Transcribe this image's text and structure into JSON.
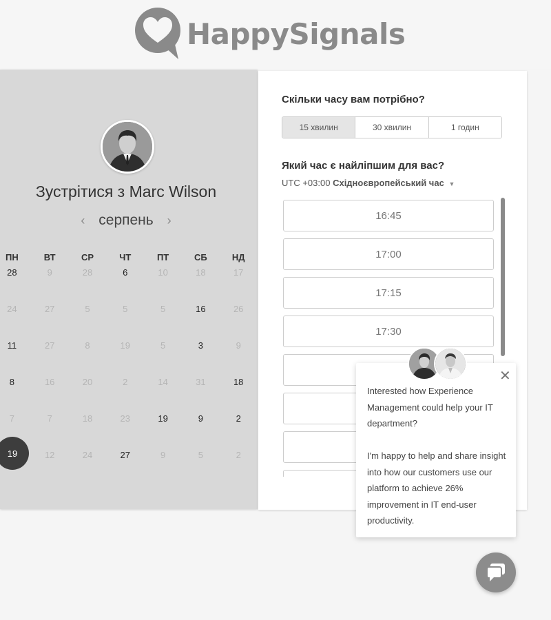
{
  "brand": {
    "name": "HappySignals",
    "logo_icon": "heart-speech-bubble-icon"
  },
  "calendar": {
    "title": "Зустрітися з Marc Wilson",
    "month": "серпень",
    "prev_icon": "chevron-left-icon",
    "next_icon": "chevron-right-icon",
    "weekdays": [
      "ПН",
      "ВТ",
      "СР",
      "ЧТ",
      "ПТ",
      "СБ",
      "НД"
    ],
    "weeks": [
      [
        "28",
        "9",
        "28",
        "6",
        "10",
        "18",
        "17"
      ],
      [
        "24",
        "27",
        "5",
        "5",
        "5",
        "16",
        "26"
      ],
      [
        "11",
        "27",
        "8",
        "19",
        "5",
        "3",
        "9"
      ],
      [
        "8",
        "16",
        "20",
        "2",
        "14",
        "31",
        "18"
      ],
      [
        "7",
        "7",
        "18",
        "23",
        "19",
        "9",
        "2"
      ],
      [
        "19",
        "12",
        "24",
        "27",
        "9",
        "5",
        "2"
      ]
    ],
    "available": [
      [
        true,
        false,
        false,
        true,
        false,
        false,
        false
      ],
      [
        false,
        false,
        false,
        false,
        false,
        true,
        false
      ],
      [
        true,
        false,
        false,
        false,
        false,
        true,
        false
      ],
      [
        true,
        false,
        false,
        false,
        false,
        false,
        true
      ],
      [
        false,
        false,
        false,
        false,
        true,
        true,
        true
      ],
      [
        true,
        false,
        false,
        true,
        false,
        false,
        false
      ]
    ],
    "selected": {
      "week": 5,
      "day": 0
    }
  },
  "booking": {
    "duration_question": "Скільки часу вам потрібно?",
    "durations": [
      "15 хвилин",
      "30 хвилин",
      "1 годин"
    ],
    "active_duration": 0,
    "time_question": "Який час є найліпшим для вас?",
    "timezone_offset": "UTC +03:00",
    "timezone_name": "Східноєвропейський час",
    "slots": [
      "16:45",
      "17:00",
      "17:15",
      "17:30",
      "",
      "",
      "",
      ""
    ]
  },
  "chat": {
    "message_1": "Interested how Experience Management could help your IT department?",
    "message_2": "I'm happy to help and share insight into how our customers use our platform to achieve 26% improvement in IT end-user productivity.",
    "close_icon": "close-icon",
    "fab_icon": "chat-bubble-icon"
  }
}
